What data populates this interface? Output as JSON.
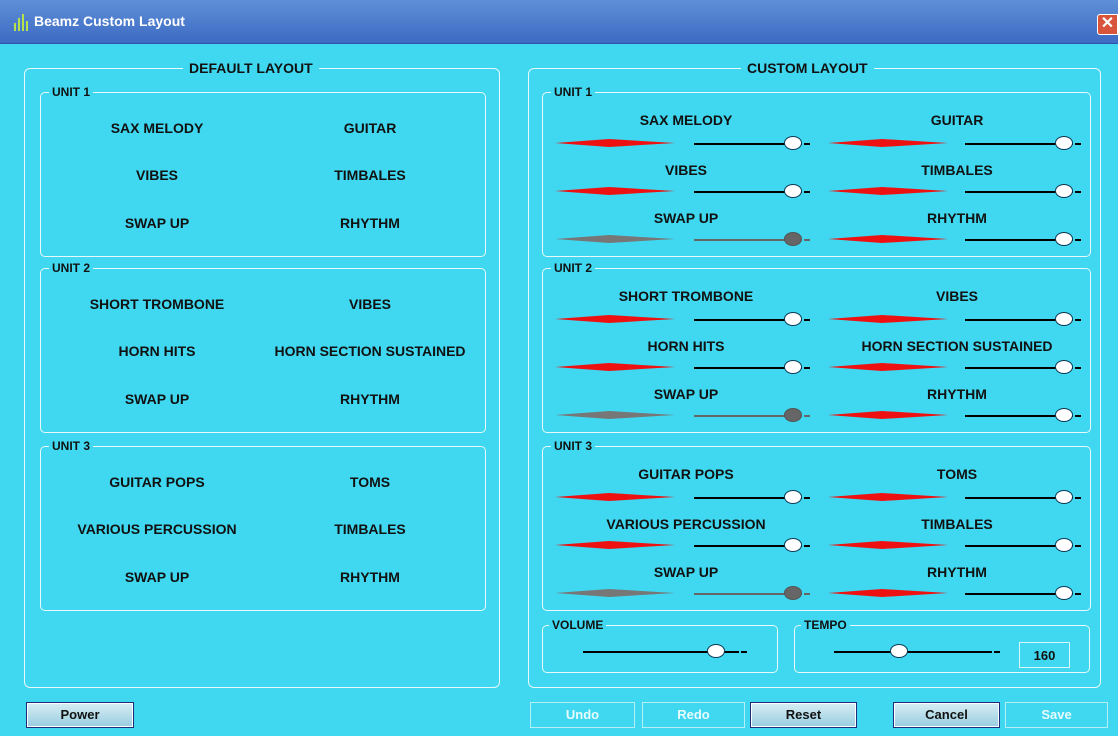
{
  "window": {
    "title": "Beamz Custom Layout",
    "close_icon": "close-icon"
  },
  "default_layout": {
    "title": "DEFAULT LAYOUT",
    "units": [
      {
        "title": "UNIT 1",
        "left": [
          "SAX MELODY",
          "VIBES",
          "SWAP UP"
        ],
        "right": [
          "GUITAR",
          "TIMBALES",
          "RHYTHM"
        ]
      },
      {
        "title": "UNIT 2",
        "left": [
          "SHORT TROMBONE",
          "HORN HITS",
          "SWAP UP"
        ],
        "right": [
          "VIBES",
          "HORN SECTION SUSTAINED",
          "RHYTHM"
        ]
      },
      {
        "title": "UNIT 3",
        "left": [
          "GUITAR POPS",
          "VARIOUS PERCUSSION",
          "SWAP UP"
        ],
        "right": [
          "TOMS",
          "TIMBALES",
          "RHYTHM"
        ]
      }
    ]
  },
  "custom_layout": {
    "title": "CUSTOM LAYOUT",
    "units": [
      {
        "title": "UNIT 1",
        "left": [
          {
            "label": "SAX MELODY",
            "enabled": true
          },
          {
            "label": "VIBES",
            "enabled": true
          },
          {
            "label": "SWAP UP",
            "enabled": false
          }
        ],
        "right": [
          {
            "label": "GUITAR",
            "enabled": true
          },
          {
            "label": "TIMBALES",
            "enabled": true
          },
          {
            "label": "RHYTHM",
            "enabled": true
          }
        ]
      },
      {
        "title": "UNIT 2",
        "left": [
          {
            "label": "SHORT TROMBONE",
            "enabled": true
          },
          {
            "label": "HORN HITS",
            "enabled": true
          },
          {
            "label": "SWAP UP",
            "enabled": false
          }
        ],
        "right": [
          {
            "label": "VIBES",
            "enabled": true
          },
          {
            "label": "HORN SECTION SUSTAINED",
            "enabled": true
          },
          {
            "label": "RHYTHM",
            "enabled": true
          }
        ]
      },
      {
        "title": "UNIT 3",
        "left": [
          {
            "label": "GUITAR POPS",
            "enabled": true
          },
          {
            "label": "VARIOUS PERCUSSION",
            "enabled": true
          },
          {
            "label": "SWAP UP",
            "enabled": false
          }
        ],
        "right": [
          {
            "label": "TOMS",
            "enabled": true
          },
          {
            "label": "TIMBALES",
            "enabled": true
          },
          {
            "label": "RHYTHM",
            "enabled": true
          }
        ]
      }
    ],
    "slider_level": 1.0,
    "volume": {
      "title": "VOLUME",
      "level": 0.9
    },
    "tempo": {
      "title": "TEMPO",
      "level": 0.4,
      "value": "160"
    }
  },
  "buttons": {
    "power": "Power",
    "undo": "Undo",
    "redo": "Redo",
    "reset": "Reset",
    "cancel": "Cancel",
    "save": "Save"
  },
  "colors": {
    "background": "#3fd8f0",
    "accent_red": "#ee1111",
    "disabled_gray": "#777777",
    "titlebar": "#4a78cc"
  }
}
